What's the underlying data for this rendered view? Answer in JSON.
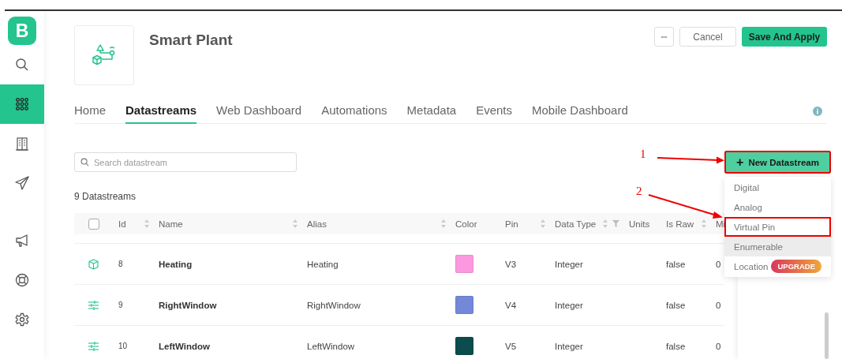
{
  "sidebar": {
    "logo": "B",
    "items": [
      {
        "selected": false
      },
      {
        "selected": true
      },
      {
        "selected": false
      },
      {
        "selected": false
      },
      {
        "selected": false
      },
      {
        "selected": false
      },
      {
        "selected": false
      }
    ]
  },
  "product": {
    "title": "Smart Plant"
  },
  "actions": {
    "more": "•••",
    "cancel": "Cancel",
    "save": "Save And Apply"
  },
  "tabs": [
    {
      "label": "Home",
      "selected": false
    },
    {
      "label": "Datastreams",
      "selected": true
    },
    {
      "label": "Web Dashboard",
      "selected": false
    },
    {
      "label": "Automations",
      "selected": false
    },
    {
      "label": "Metadata",
      "selected": false
    },
    {
      "label": "Events",
      "selected": false
    },
    {
      "label": "Mobile Dashboard",
      "selected": false
    }
  ],
  "search": {
    "placeholder": "Search datastream"
  },
  "count": "9 Datastreams",
  "new_button": {
    "label": "New Datastream",
    "icon": "+",
    "marked": true
  },
  "menu": [
    {
      "label": "Digital",
      "hovered": false,
      "marked": false
    },
    {
      "label": "Analog",
      "hovered": false,
      "marked": false
    },
    {
      "label": "Virtual Pin",
      "hovered": false,
      "marked": true
    },
    {
      "label": "Enumerable",
      "hovered": true,
      "marked": false
    },
    {
      "label": "Location",
      "hovered": false,
      "marked": false,
      "badge": "UPGRADE"
    }
  ],
  "table": {
    "select_all": {
      "checked": false
    },
    "columns": [
      {
        "label": "Id",
        "sortable": true,
        "filterable": false
      },
      {
        "label": "Name",
        "sortable": true,
        "filterable": false
      },
      {
        "label": "Alias",
        "sortable": true,
        "filterable": false
      },
      {
        "label": "Color",
        "sortable": false,
        "filterable": false
      },
      {
        "label": "Pin",
        "sortable": true,
        "filterable": false
      },
      {
        "label": "Data Type",
        "sortable": true,
        "filterable": true
      },
      {
        "label": "Units",
        "sortable": false,
        "filterable": false
      },
      {
        "label": "Is Raw",
        "sortable": true,
        "filterable": false
      },
      {
        "label": "Mi"
      }
    ],
    "rows": [
      {
        "kind": "cube",
        "id": "8",
        "name": "Heating",
        "alias": "Heating",
        "color": "#fb98e0",
        "pin": "V3",
        "data_type": "Integer",
        "is_raw": "false",
        "min": "0"
      },
      {
        "kind": "sliders",
        "id": "9",
        "name": "RightWindow",
        "alias": "RightWindow",
        "color": "#7388d9",
        "pin": "V4",
        "data_type": "Integer",
        "is_raw": "false",
        "min": "0"
      },
      {
        "kind": "sliders",
        "id": "10",
        "name": "LeftWindow",
        "alias": "LeftWindow",
        "color": "#0c4c4c",
        "pin": "V5",
        "data_type": "Integer",
        "is_raw": "false",
        "min": "0"
      }
    ]
  },
  "annotations": [
    {
      "label": "1"
    },
    {
      "label": "2"
    }
  ]
}
